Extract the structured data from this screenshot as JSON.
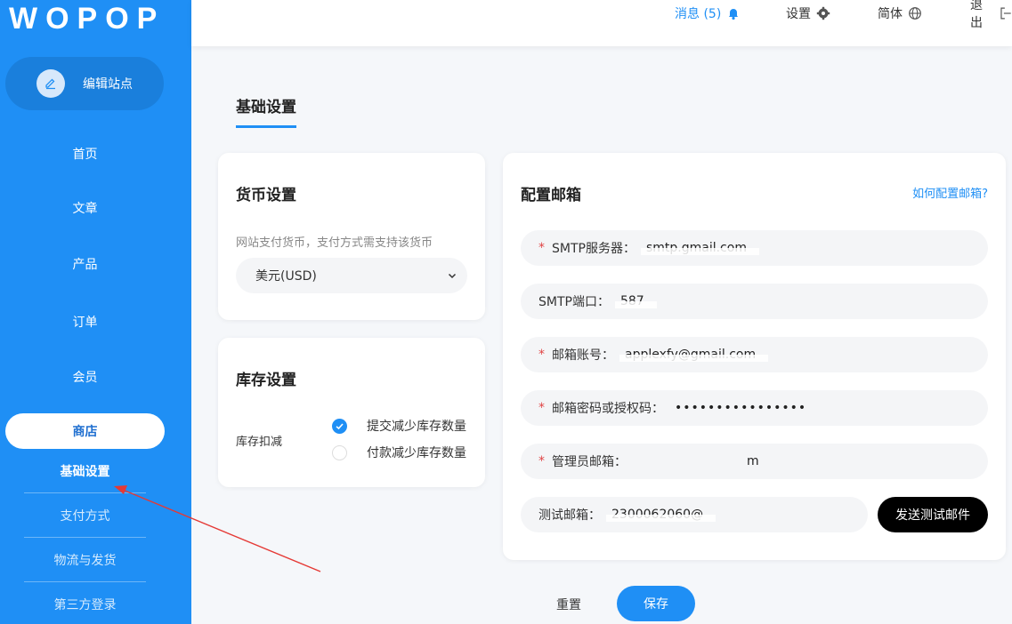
{
  "logo": "WOPOP",
  "sidebar": {
    "edit_site": "编辑站点",
    "items": [
      {
        "label": "首页"
      },
      {
        "label": "文章"
      },
      {
        "label": "产品"
      },
      {
        "label": "订单"
      },
      {
        "label": "会员"
      },
      {
        "label": "商店"
      }
    ],
    "subitems": [
      {
        "label": "基础设置"
      },
      {
        "label": "支付方式"
      },
      {
        "label": "物流与发货"
      },
      {
        "label": "第三方登录"
      }
    ]
  },
  "topbar": {
    "messages": "消息 (5)",
    "settings": "设置",
    "language": "简体",
    "logout": "退出"
  },
  "page_tab": "基础设置",
  "currency": {
    "title": "货币设置",
    "desc": "网站支付货币，支付方式需支持该货币",
    "selected": "美元(USD)"
  },
  "stock": {
    "title": "库存设置",
    "label": "库存扣减",
    "option1": "提交减少库存数量",
    "option2": "付款减少库存数量"
  },
  "mail": {
    "title": "配置邮箱",
    "help": "如何配置邮箱?",
    "smtp_server_label": "SMTP服务器：",
    "smtp_server_value": "smtp.gmail.com",
    "smtp_port_label": "SMTP端口：",
    "smtp_port_value": "587",
    "account_label": "邮箱账号：",
    "account_value": "applexfy@gmail.com",
    "password_label": "邮箱密码或授权码：",
    "password_value": "••••••••••••••••",
    "admin_label": "管理员邮箱：",
    "admin_value": "m",
    "test_label": "测试邮箱：",
    "test_value": "2300062060@",
    "send_button": "发送测试邮件"
  },
  "actions": {
    "reset": "重置",
    "save": "保存"
  },
  "colors": {
    "brand": "#1f8ff5",
    "required": "#e04444",
    "sidebar": "#1f8ff5"
  }
}
